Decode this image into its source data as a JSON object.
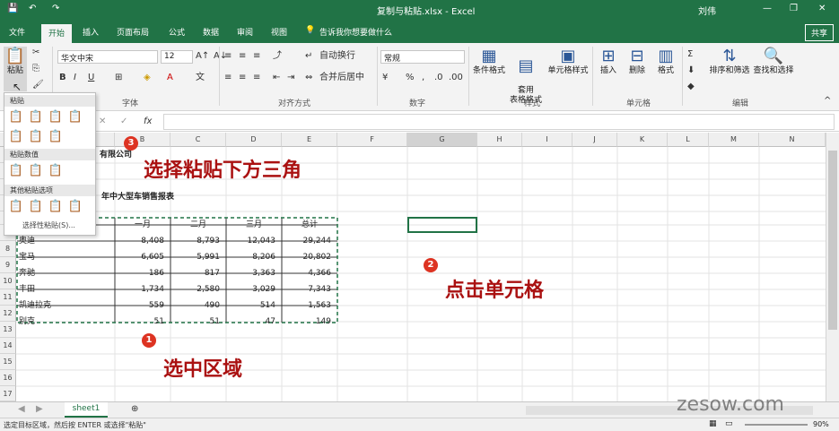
{
  "titlebar": {
    "file_title": "复制与粘贴.xlsx - Excel",
    "user": "刘伟"
  },
  "tabs": [
    "文件",
    "开始",
    "插入",
    "页面布局",
    "公式",
    "数据",
    "审阅",
    "视图"
  ],
  "tell_me": "告诉我你想要做什么",
  "share": "共享",
  "ribbon": {
    "paste_label": "粘贴",
    "font_name": "华文中宋",
    "font_size": "12",
    "wrap_text": "自动换行",
    "merge_center": "合并后居中",
    "number_format": "常规",
    "cond_format": "条件格式",
    "table_format": "套用\n表格格式",
    "cell_styles": "单元格样式",
    "insert": "插入",
    "delete": "删除",
    "format": "格式",
    "sort_filter": "排序和筛选",
    "find_select": "查找和选择",
    "groups": {
      "font": "字体",
      "alignment": "对齐方式",
      "number": "数字",
      "styles": "样式",
      "cells": "单元格",
      "editing": "编辑"
    }
  },
  "paste_menu": {
    "section_paste": "粘贴",
    "section_values": "粘贴数值",
    "section_other": "其他粘贴选项",
    "paste_special": "选择性粘贴(S)..."
  },
  "columns": [
    "B",
    "C",
    "D",
    "E",
    "F",
    "G",
    "H",
    "I",
    "J",
    "K",
    "L",
    "M",
    "N"
  ],
  "rows": [
    "7",
    "8",
    "9",
    "10",
    "11",
    "12",
    "13",
    "14",
    "15",
    "16",
    "17",
    "18"
  ],
  "sheet": {
    "company": "有限公司",
    "report_title": "年中大型车销售报表",
    "headers": [
      "一月",
      "二月",
      "三月",
      "总计"
    ],
    "table": [
      {
        "name": "奥迪",
        "v": [
          "8,408",
          "8,793",
          "12,043",
          "29,244"
        ]
      },
      {
        "name": "宝马",
        "v": [
          "6,605",
          "5,991",
          "8,206",
          "20,802"
        ]
      },
      {
        "name": "奔驰",
        "v": [
          "186",
          "817",
          "3,363",
          "4,366"
        ]
      },
      {
        "name": "丰田",
        "v": [
          "1,734",
          "2,580",
          "3,029",
          "7,343"
        ]
      },
      {
        "name": "凯迪拉克",
        "v": [
          "559",
          "490",
          "514",
          "1,563"
        ]
      },
      {
        "name": "别克",
        "v": [
          "51",
          "51",
          "47",
          "149"
        ]
      }
    ]
  },
  "annotations": {
    "a1_num": "1",
    "a1_text": "选中区域",
    "a2_num": "2",
    "a2_text": "点击单元格",
    "a3_num": "3",
    "a3_text": "选择粘贴下方三角"
  },
  "sheet_tab": "sheet1",
  "status_text": "选定目标区域，然后按 ENTER 或选择\"粘贴\"",
  "zoom": "90%",
  "watermark": "zesow.com"
}
